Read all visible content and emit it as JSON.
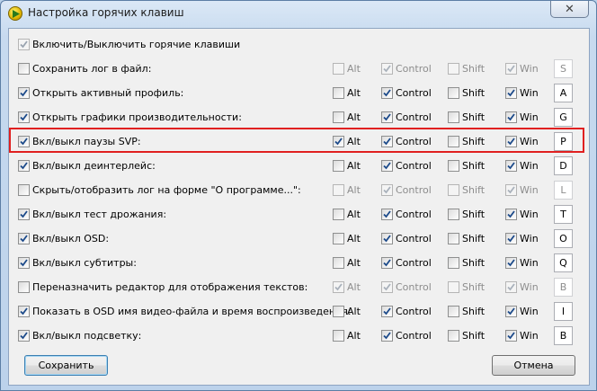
{
  "window": {
    "title": "Настройка горячих клавиш",
    "close_glyph": "✕"
  },
  "master": {
    "label": "Включить/Выключить горячие клавиши",
    "checked": true,
    "disabled": true
  },
  "modifiers": [
    "Alt",
    "Control",
    "Shift",
    "Win"
  ],
  "rows": [
    {
      "label": "Сохранить лог в файл:",
      "enabled": false,
      "alt": false,
      "control": true,
      "shift": false,
      "win": true,
      "key": "S"
    },
    {
      "label": "Открыть активный профиль:",
      "enabled": true,
      "alt": false,
      "control": true,
      "shift": false,
      "win": true,
      "key": "A"
    },
    {
      "label": "Открыть графики производительности:",
      "enabled": true,
      "alt": false,
      "control": true,
      "shift": false,
      "win": true,
      "key": "G"
    },
    {
      "label": "Вкл/выкл паузы SVP:",
      "enabled": true,
      "alt": true,
      "control": true,
      "shift": false,
      "win": true,
      "key": "P"
    },
    {
      "label": "Вкл/выкл деинтерлейс:",
      "enabled": true,
      "alt": false,
      "control": true,
      "shift": false,
      "win": true,
      "key": "D"
    },
    {
      "label": "Скрыть/отобразить лог на форме \"О программе...\":",
      "enabled": false,
      "alt": false,
      "control": true,
      "shift": false,
      "win": true,
      "key": "L"
    },
    {
      "label": "Вкл/выкл тест дрожания:",
      "enabled": true,
      "alt": false,
      "control": true,
      "shift": false,
      "win": true,
      "key": "T"
    },
    {
      "label": "Вкл/выкл OSD:",
      "enabled": true,
      "alt": false,
      "control": true,
      "shift": false,
      "win": true,
      "key": "O"
    },
    {
      "label": "Вкл/выкл субтитры:",
      "enabled": true,
      "alt": false,
      "control": true,
      "shift": false,
      "win": true,
      "key": "Q"
    },
    {
      "label": "Переназначить редактор для отображения текстов:",
      "enabled": false,
      "alt": true,
      "control": true,
      "shift": false,
      "win": true,
      "key": "B"
    },
    {
      "label": "Показать в OSD имя видео-файла и время воспроизведения:",
      "enabled": true,
      "alt": false,
      "control": true,
      "shift": false,
      "win": true,
      "key": "I"
    },
    {
      "label": "Вкл/выкл подсветку:",
      "enabled": true,
      "alt": false,
      "control": true,
      "shift": false,
      "win": true,
      "key": "B"
    }
  ],
  "buttons": {
    "save": "Сохранить",
    "cancel": "Отмена"
  },
  "colors": {
    "highlight": "#e02020",
    "check": "#1c4a8a"
  }
}
